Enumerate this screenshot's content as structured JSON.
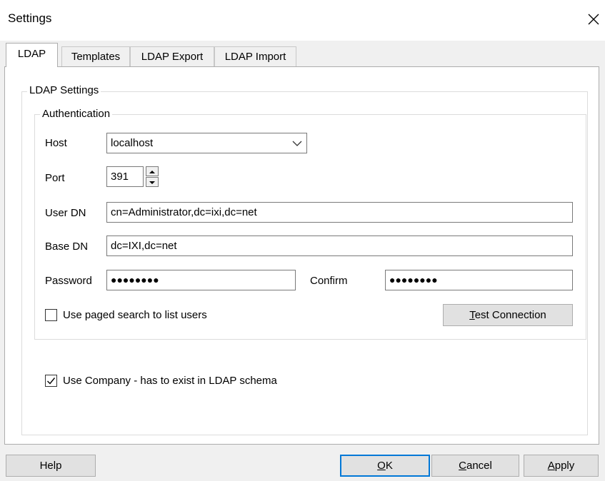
{
  "window": {
    "title": "Settings",
    "close_glyph": "close-icon"
  },
  "tabs": [
    {
      "label": "LDAP",
      "active": true
    },
    {
      "label": "Templates",
      "active": false
    },
    {
      "label": "LDAP Export",
      "active": false
    },
    {
      "label": "LDAP Import",
      "active": false
    }
  ],
  "ldap_settings": {
    "legend": "LDAP Settings",
    "authentication": {
      "legend": "Authentication",
      "host_label": "Host",
      "host_value": "localhost",
      "port_label": "Port",
      "port_value": "391",
      "user_dn_label": "User DN",
      "user_dn_value": "cn=Administrator,dc=ixi,dc=net",
      "base_dn_label": "Base DN",
      "base_dn_value": "dc=IXI,dc=net",
      "password_label": "Password",
      "password_value": "●●●●●●●●",
      "confirm_label": "Confirm",
      "confirm_value": "●●●●●●●●",
      "paged_search_label": "Use paged search to list users",
      "paged_search_checked": false,
      "test_connection_pre": "",
      "test_connection_ul": "T",
      "test_connection_post": "est Connection"
    },
    "use_company_label": "Use Company - has to exist in LDAP schema",
    "use_company_checked": true
  },
  "buttons": {
    "help": "Help",
    "ok_ul": "O",
    "ok_post": "K",
    "cancel_ul": "C",
    "cancel_post": "ancel",
    "apply_ul": "A",
    "apply_post": "pply"
  },
  "colors": {
    "accent": "#0078d7",
    "dialog_bg": "#f0f0f0",
    "panel_bg": "#ffffff"
  }
}
